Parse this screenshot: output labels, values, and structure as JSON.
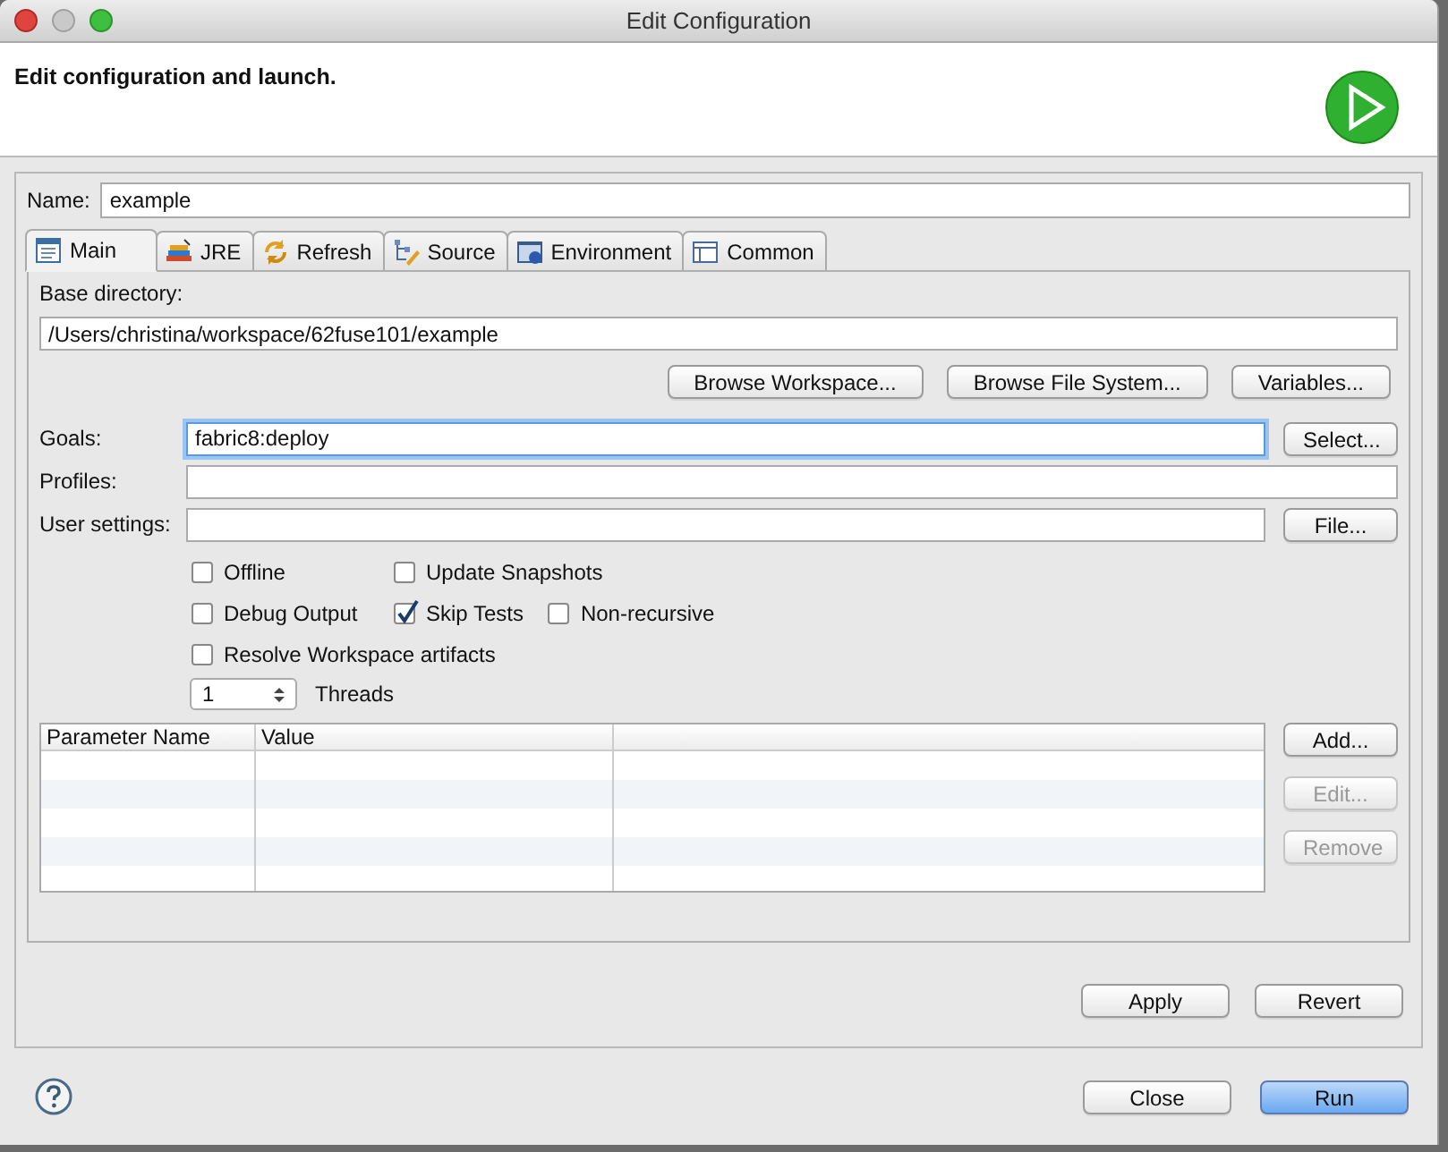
{
  "window": {
    "title": "Edit Configuration"
  },
  "header": {
    "message": "Edit configuration and launch."
  },
  "name_field": {
    "label": "Name:",
    "value": "example"
  },
  "tabs": [
    {
      "label": "Main",
      "selected": true
    },
    {
      "label": "JRE",
      "selected": false
    },
    {
      "label": "Refresh",
      "selected": false
    },
    {
      "label": "Source",
      "selected": false
    },
    {
      "label": "Environment",
      "selected": false
    },
    {
      "label": "Common",
      "selected": false
    }
  ],
  "base_directory": {
    "label": "Base directory:",
    "value": "/Users/christina/workspace/62fuse101/example"
  },
  "browse_buttons": [
    {
      "label": "Browse Workspace..."
    },
    {
      "label": "Browse File System..."
    },
    {
      "label": "Variables..."
    }
  ],
  "fields": [
    {
      "label": "Goals:",
      "value": "fabric8:deploy",
      "focused": true,
      "button": "Select..."
    },
    {
      "label": "Profiles:",
      "focused": false
    },
    {
      "label": "User settings:",
      "focused": false,
      "button": "File..."
    }
  ],
  "options": [
    [
      {
        "label": "Offline",
        "checked": false
      },
      {
        "label": "Update Snapshots",
        "checked": false
      }
    ],
    [
      {
        "label": "Debug Output",
        "checked": false
      },
      {
        "label": "Skip Tests",
        "checked": true
      },
      {
        "label": "Non-recursive",
        "checked": false
      }
    ],
    [
      {
        "label": "Resolve Workspace artifacts",
        "checked": false
      }
    ]
  ],
  "threads": {
    "value": "1",
    "label": "Threads"
  },
  "parameters": {
    "columns": [
      "Parameter Name",
      "Value"
    ],
    "buttons": [
      {
        "label": "Add...",
        "disabled": false
      },
      {
        "label": "Edit...",
        "disabled": true
      },
      {
        "label": "Remove",
        "disabled": true
      }
    ]
  },
  "panel_buttons": [
    {
      "label": "Apply"
    },
    {
      "label": "Revert"
    }
  ],
  "footer_buttons": [
    {
      "label": "Close",
      "default": false
    },
    {
      "label": "Run",
      "default": true
    }
  ]
}
